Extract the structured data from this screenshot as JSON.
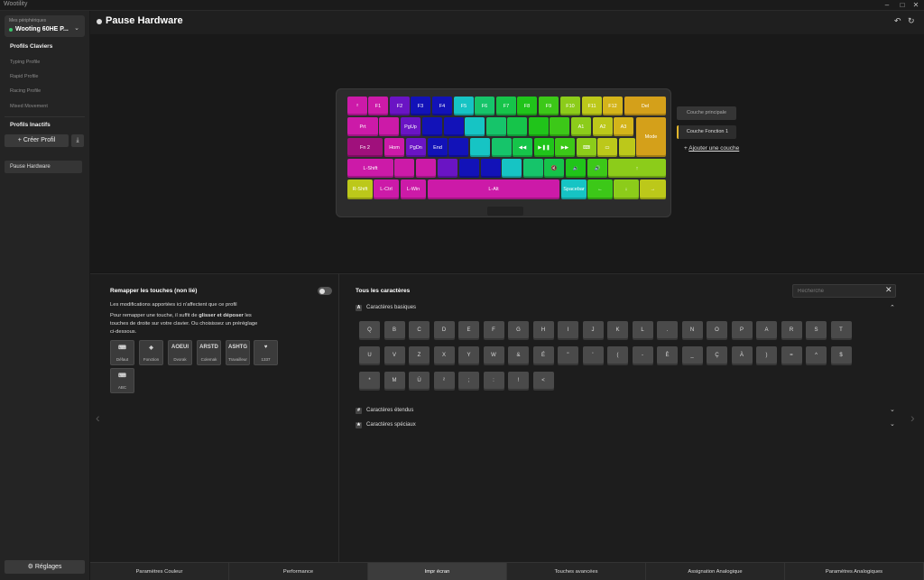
{
  "window": {
    "title": "Wootility",
    "min": "–",
    "max": "□",
    "close": "✕"
  },
  "sidebar": {
    "device_label": "Mes périphériques",
    "device_name": "Wooting 60HE P...",
    "profiles_header": "Profils Claviers",
    "profiles": [
      "Typing Profile",
      "Rapid Profile",
      "Racing Profile",
      "Mixed Movement"
    ],
    "inactive_header": "Profils Inactifs",
    "create_label": "Créer Profil",
    "inactive_profiles": [
      "Pause Hardware"
    ],
    "settings_label": "Réglages"
  },
  "header": {
    "title": "Pause Hardware"
  },
  "layers": {
    "main": "Couche principale",
    "fn1": "Couche Fonction 1",
    "add": "Ajouter une couche"
  },
  "keyboard": {
    "keys": [
      {
        "label": "²",
        "color": "#cc1aa8"
      },
      {
        "label": "F1",
        "color": "#cc1aa8"
      },
      {
        "label": "F2",
        "color": "#6a14c4"
      },
      {
        "label": "F3",
        "color": "#1212b8"
      },
      {
        "label": "F4",
        "color": "#1212b8"
      },
      {
        "label": "F5",
        "color": "#16c4c4"
      },
      {
        "label": "F6",
        "color": "#16c46a"
      },
      {
        "label": "F7",
        "color": "#16c44a"
      },
      {
        "label": "F8",
        "color": "#20c41a"
      },
      {
        "label": "F9",
        "color": "#3cc818"
      },
      {
        "label": "F10",
        "color": "#8ccc1a"
      },
      {
        "label": "F11",
        "color": "#bcc81a"
      },
      {
        "label": "F12",
        "color": "#d4b41a"
      },
      {
        "label": "Del",
        "color": "#d4a01a"
      },
      {
        "label": "Prt",
        "color": "#cc1aa8"
      },
      {
        "label": "",
        "color": "#cc1aa8"
      },
      {
        "label": "PgUp",
        "color": "#6a14c4"
      },
      {
        "label": "",
        "color": "#1212b8"
      },
      {
        "label": "",
        "color": "#1212b8"
      },
      {
        "label": "",
        "color": "#16c4c4"
      },
      {
        "label": "",
        "color": "#16c46a"
      },
      {
        "label": "",
        "color": "#16c44a"
      },
      {
        "label": "",
        "color": "#20c41a"
      },
      {
        "label": "",
        "color": "#3cc818"
      },
      {
        "label": "A1",
        "color": "#8ccc1a"
      },
      {
        "label": "A2",
        "color": "#bcc81a"
      },
      {
        "label": "A3",
        "color": "#d4b41a"
      },
      {
        "label": "Mode",
        "color": "#d4a01a"
      },
      {
        "label": "Fn 2",
        "color": "#a0107c"
      },
      {
        "label": "Hom",
        "color": "#cc1aa8"
      },
      {
        "label": "PgDn",
        "color": "#6a14c4"
      },
      {
        "label": "End",
        "color": "#1212b8"
      },
      {
        "label": "",
        "color": "#1212b8"
      },
      {
        "label": "",
        "color": "#16c4c4"
      },
      {
        "label": "",
        "color": "#16c46a"
      },
      {
        "label": "◀◀",
        "color": "#16c44a"
      },
      {
        "label": "▶❚❚",
        "color": "#20c41a"
      },
      {
        "label": "▶▶",
        "color": "#3cc818"
      },
      {
        "label": "⌨",
        "color": "#8ccc1a"
      },
      {
        "label": "▭",
        "color": "#bcc81a"
      },
      {
        "label": "",
        "color": "#bcc81a"
      },
      {
        "label": "L-Shift",
        "color": "#cc1aa8"
      },
      {
        "label": "",
        "color": "#cc1aa8"
      },
      {
        "label": "",
        "color": "#cc1aa8"
      },
      {
        "label": "",
        "color": "#6a14c4"
      },
      {
        "label": "",
        "color": "#1212b8"
      },
      {
        "label": "",
        "color": "#1212b8"
      },
      {
        "label": "",
        "color": "#16c4c4"
      },
      {
        "label": "",
        "color": "#16c46a"
      },
      {
        "label": "🔇",
        "color": "#16c44a"
      },
      {
        "label": "🔉",
        "color": "#20c41a"
      },
      {
        "label": "🔊",
        "color": "#3cc818"
      },
      {
        "label": "↑",
        "color": "#8ccc1a"
      },
      {
        "label": "R-Shift",
        "color": "#bcc81a"
      },
      {
        "label": "L-Ctrl",
        "color": "#cc1aa8"
      },
      {
        "label": "L-Win",
        "color": "#cc1aa8"
      },
      {
        "label": "L-Alt",
        "color": "#cc1aa8"
      },
      {
        "label": "Spacebar",
        "color": "#16c4c4"
      },
      {
        "label": "←",
        "color": "#3cc818"
      },
      {
        "label": "↓",
        "color": "#8ccc1a"
      },
      {
        "label": "→",
        "color": "#bcc81a"
      },
      {
        "label": "Fn 1",
        "color": "#d4a01a"
      }
    ]
  },
  "remap": {
    "title": "Remapper les touches (non lié)",
    "info1": "Les modifications apportées ici n'affectent que ce profil",
    "info2a": "Pour remapper une touche, il suffit de ",
    "info2b": "glisser et déposer",
    "info2c": " les",
    "info3": "touches de droite sur votre clavier. Ou choisissez un préréglage",
    "info4": "ci-dessous.",
    "presets": [
      {
        "icon": "⌨",
        "label": "Défaut"
      },
      {
        "icon": "◈",
        "label": "Fonction"
      },
      {
        "icon": "AOEUI",
        "label": "Dvorak"
      },
      {
        "icon": "ARSTD",
        "label": "Colemak"
      },
      {
        "icon": "ASHTG",
        "label": "Travailleur"
      },
      {
        "icon": "♥",
        "label": "1337"
      },
      {
        "icon": "⌨",
        "label": "ABC"
      }
    ]
  },
  "chars": {
    "title": "Tous les caractères",
    "search_placeholder": "Recherche",
    "basic_title": "Caractères basiques",
    "basic_keys": [
      "Q",
      "B",
      "C",
      "D",
      "E",
      "F",
      "G",
      "H",
      "I",
      "J",
      "K",
      "L",
      ".",
      "N",
      "O",
      "P",
      "A",
      "R",
      "S",
      "T",
      "U",
      "V",
      "Z",
      "X",
      "Y",
      "W",
      "&",
      "É",
      "\"",
      "'",
      "(",
      "-",
      "È",
      "_",
      "Ç",
      "À",
      ")",
      "=",
      "^",
      "$",
      "*",
      "M",
      "Ù",
      "²",
      ";",
      ":",
      "!",
      "<"
    ],
    "extended_title": "Caractères étendus",
    "special_title": "Caractères spéciaux",
    "badges": {
      "basic": "A",
      "extended": "#",
      "special": "★"
    }
  },
  "tabs": [
    {
      "label": "Paramètres Couleur"
    },
    {
      "label": "Performance"
    },
    {
      "label": "Impr écran"
    },
    {
      "label": "Touches avancées"
    },
    {
      "label": "Assignation Analogique"
    },
    {
      "label": "Paramètres Analogiques"
    }
  ]
}
